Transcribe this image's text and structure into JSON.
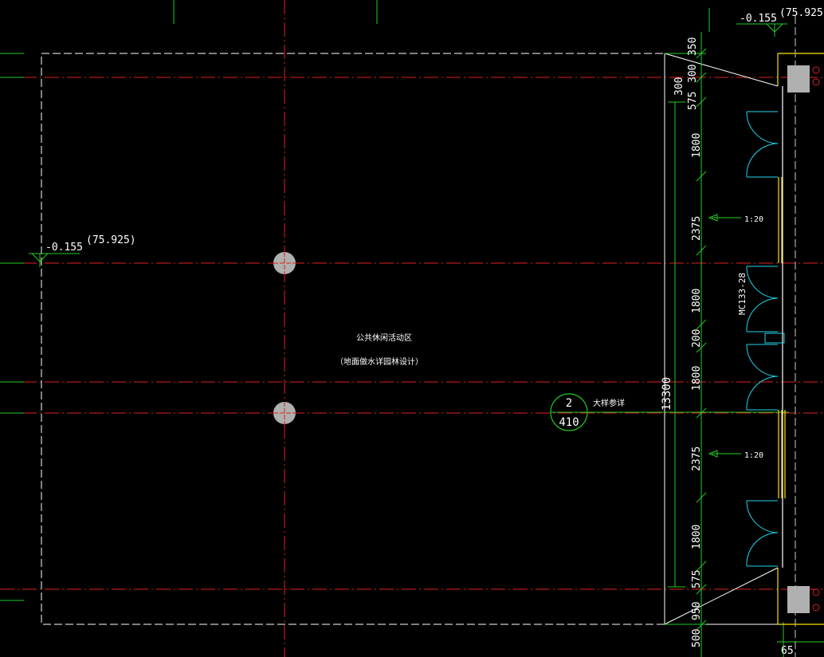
{
  "colors": {
    "background": "#000000",
    "axis_red": "#e02020",
    "dim_green": "#22cc22",
    "boundary_white": "#ffffff",
    "door_cyan": "#22d3ee",
    "wall_yellow": "#ffe600",
    "column_gray": "#b0b0b0"
  },
  "level_marks": [
    {
      "value": "-0.155",
      "absolute": "(75.925)"
    },
    {
      "value": "-0.155",
      "absolute": "(75.925"
    }
  ],
  "area_label": {
    "line1": "公共休闲活动区",
    "line2": "（地面做水详园林设计）"
  },
  "detail_callout": {
    "number": "2",
    "sheet": "410",
    "note": "大样参详"
  },
  "slope_labels": [
    "1:20",
    "1:20"
  ],
  "door_tag": "MC133-28",
  "total_dimension": "13300",
  "inner_dimension": "300",
  "dimensions": [
    "350",
    "300",
    "575",
    "1800",
    "2375",
    "1800",
    "200",
    "1800",
    "2375",
    "1800",
    "575",
    "950",
    "500"
  ],
  "bottom_dimension": "65",
  "icons": [
    "column-icon",
    "detail-callout-icon",
    "level-marker-icon",
    "arrow-icon",
    "door-swing-icon"
  ]
}
